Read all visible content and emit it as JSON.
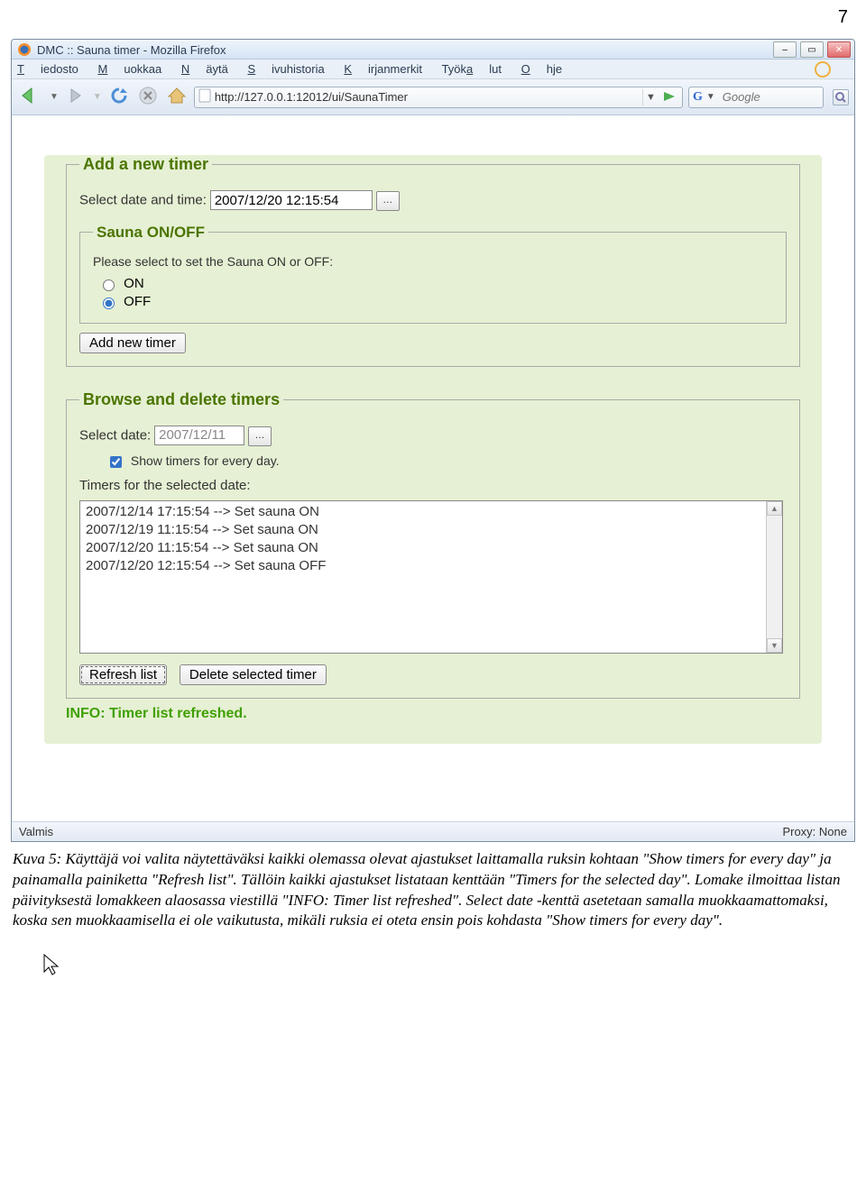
{
  "page_number": "7",
  "window": {
    "title": "DMC :: Sauna timer - Mozilla Firefox",
    "win_buttons": {
      "min": "–",
      "max": "▭",
      "close": "✕"
    }
  },
  "menubar": {
    "tiedosto": "Tiedosto",
    "muokkaa": "Muokkaa",
    "nayta": "Näytä",
    "sivuhistoria": "Sivuhistoria",
    "kirjanmerkit": "Kirjanmerkit",
    "tyokalut": "Työkalut",
    "ohje": "Ohje"
  },
  "toolbar": {
    "url": "http://127.0.0.1:12012/ui/SaunaTimer",
    "search_engine": "G",
    "search_placeholder": "Google"
  },
  "form": {
    "add_legend": "Add a new timer",
    "select_dt_label": "Select date and time:",
    "dt_value": "2007/12/20 12:15:54",
    "sauna_legend": "Sauna ON/OFF",
    "sauna_prompt": "Please select to set the Sauna ON or OFF:",
    "opt_on": "ON",
    "opt_off": "OFF",
    "add_button": "Add new timer",
    "browse_legend": "Browse and delete timers",
    "select_date_label": "Select date:",
    "date_value": "2007/12/11",
    "show_every_label": "Show timers for every day.",
    "timers_for_label": "Timers for the selected date:",
    "list": [
      "2007/12/14 17:15:54 --> Set sauna ON",
      "2007/12/19 11:15:54 --> Set sauna ON",
      "2007/12/20 11:15:54 --> Set sauna ON",
      "2007/12/20 12:15:54 --> Set sauna OFF"
    ],
    "refresh_button": "Refresh list",
    "delete_button": "Delete selected timer",
    "info_line": "INFO: Timer list refreshed."
  },
  "statusbar": {
    "left": "Valmis",
    "right": "Proxy: None"
  },
  "caption": "Kuva 5: Käyttäjä voi valita näytettäväksi kaikki olemassa olevat ajastukset laittamalla ruksin kohtaan \"Show timers for every day\" ja painamalla painiketta \"Refresh list\". Tällöin kaikki ajastukset listataan kenttään \"Timers for the selected day\". Lomake ilmoittaa listan päivityksestä lomakkeen alaosassa viestillä \"INFO: Timer list refreshed\". Select date -kenttä asetetaan samalla muokkaamattomaksi, koska sen muokkaamisella ei ole vaikutusta, mikäli ruksia ei oteta ensin pois kohdasta \"Show timers for every day\"."
}
